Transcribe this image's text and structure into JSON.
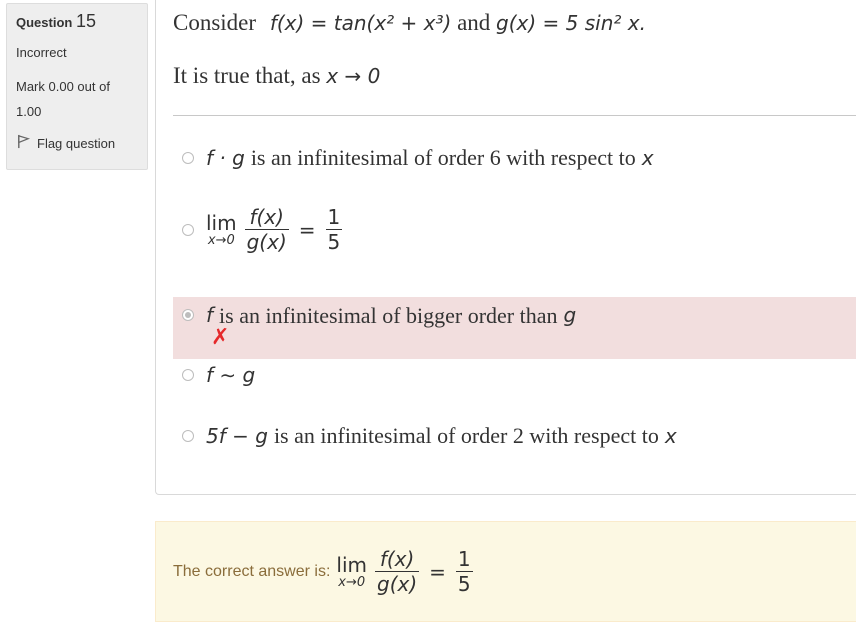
{
  "info": {
    "question_label": "Question",
    "question_number": "15",
    "state": "Incorrect",
    "grade": "Mark 0.00 out of 1.00",
    "flag_label": "Flag question"
  },
  "question": {
    "intro_word": "Consider",
    "f_def": "f(x) = tan(x² + x³)",
    "and_word": "and",
    "g_def": "g(x) = 5 sin² x.",
    "line2_text": "It is true that, as",
    "line2_math": "x → 0"
  },
  "options": [
    {
      "math_prefix": "f · g",
      "text": "is an infinitesimal of order 6 with respect to",
      "math_suffix": "x",
      "selected": false
    },
    {
      "lim": "lim",
      "lim_sub": "x→0",
      "num": "f(x)",
      "den": "g(x)",
      "eq": "=",
      "rhs_num": "1",
      "rhs_den": "5",
      "selected": false
    },
    {
      "math_prefix": "f",
      "text": "is an infinitesimal of bigger order than",
      "math_suffix": "g",
      "selected": true,
      "mark": "✗"
    },
    {
      "math_prefix": "f ∼ g",
      "text": "",
      "math_suffix": "",
      "selected": false
    },
    {
      "math_prefix": "5f − g",
      "text": "is an infinitesimal of order 2 with respect to",
      "math_suffix": "x",
      "selected": false
    }
  ],
  "feedback": {
    "label": "The correct answer is:",
    "lim": "lim",
    "lim_sub": "x→0",
    "num": "f(x)",
    "den": "g(x)",
    "eq": "=",
    "rhs_num": "1",
    "rhs_den": "5"
  },
  "colors": {
    "incorrect_bg": "#f2dede",
    "feedback_bg": "#fcf8e3",
    "feedback_text": "#8a6d3b",
    "cross": "#e5292b"
  }
}
